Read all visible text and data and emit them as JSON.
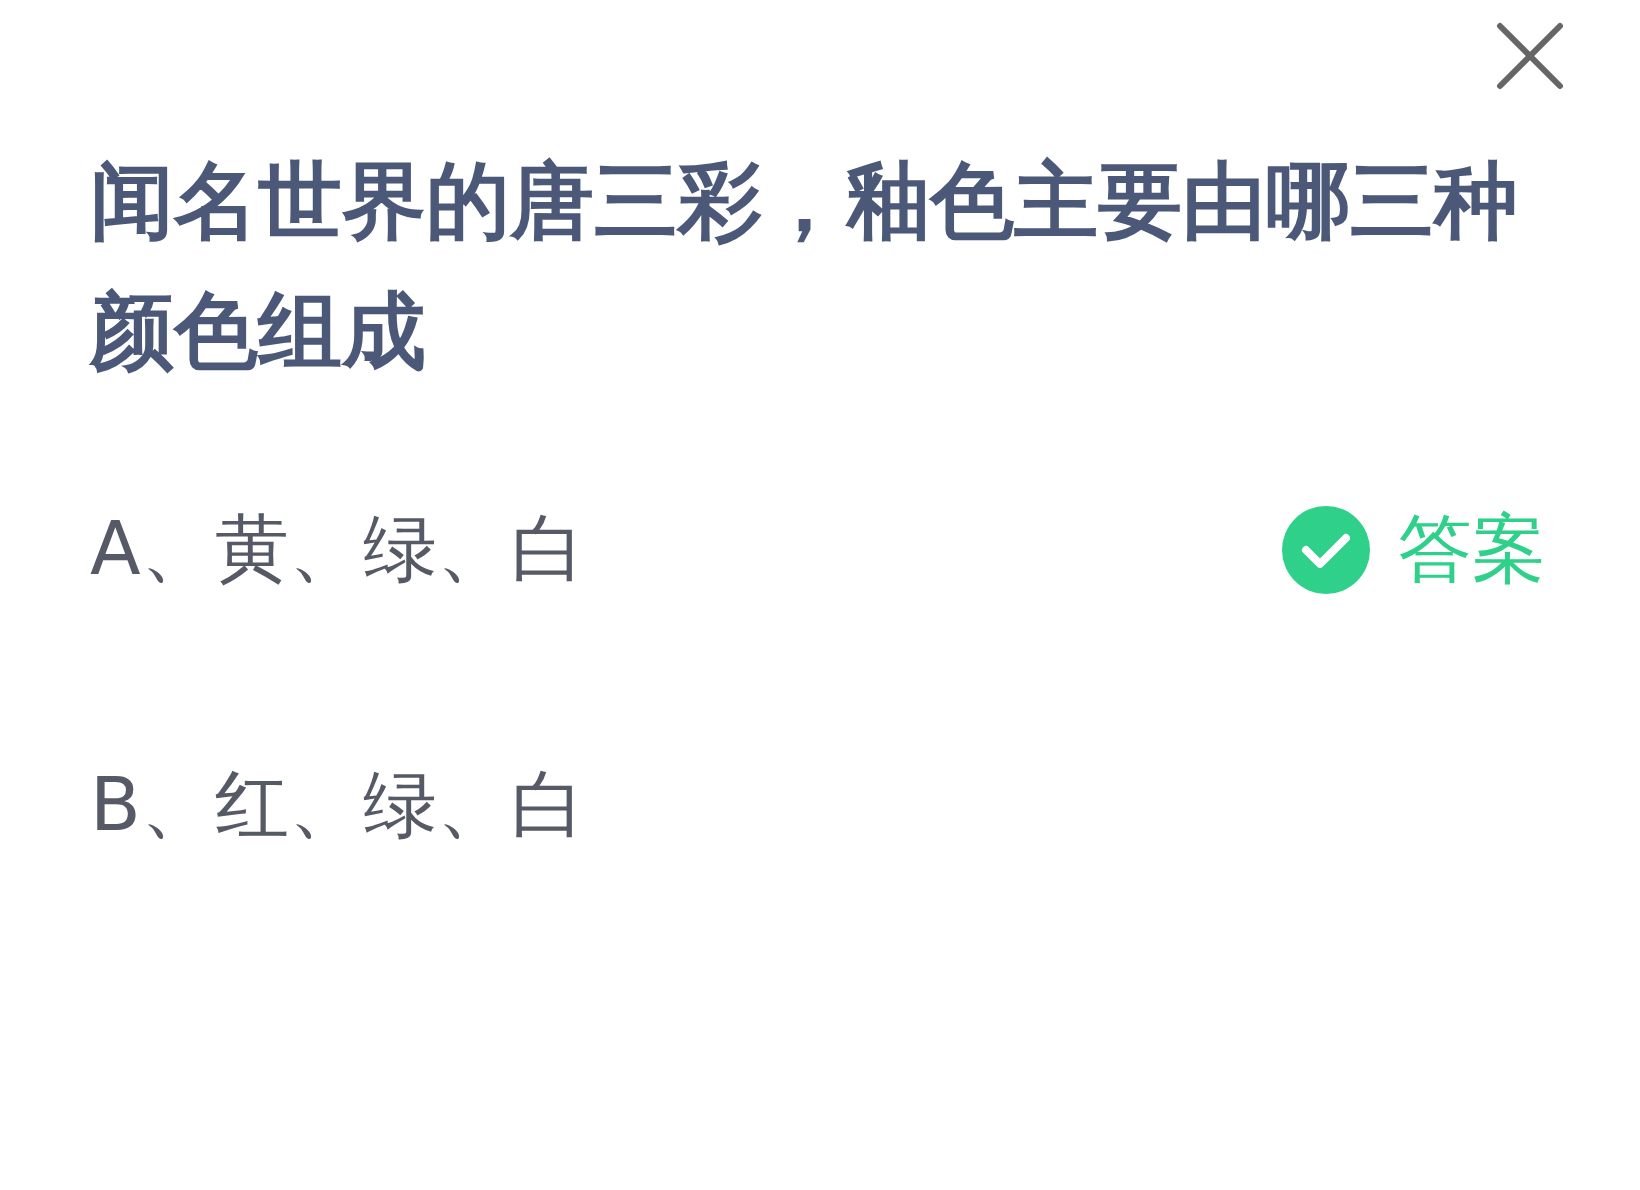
{
  "question": "闻名世界的唐三彩，釉色主要由哪三种颜色组成",
  "answer_label": "答案",
  "options": [
    {
      "label": "A、黄、绿、白",
      "correct": true
    },
    {
      "label": "B、红、绿、白",
      "correct": false
    }
  ]
}
